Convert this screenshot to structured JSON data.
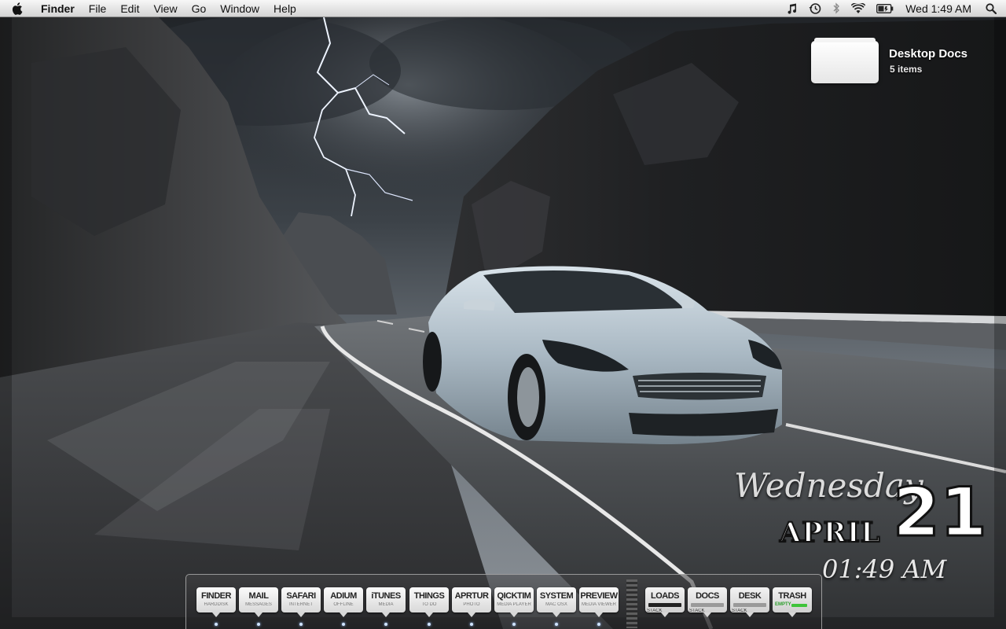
{
  "menubar": {
    "app_name": "Finder",
    "menus": [
      "File",
      "Edit",
      "View",
      "Go",
      "Window",
      "Help"
    ],
    "status_icons": [
      "itunes-note-icon",
      "time-machine-icon",
      "bluetooth-icon",
      "wifi-icon",
      "battery-icon"
    ],
    "clock": "Wed 1:49 AM"
  },
  "desktop": {
    "stack_name": "Desktop Docs",
    "stack_count": "5 items"
  },
  "date_widget": {
    "weekday": "Wednesday",
    "month": "APRIL",
    "day": "21",
    "time": "01:49 AM"
  },
  "dock": {
    "apps": [
      {
        "label": "FINDER",
        "sub": "HARDDISK",
        "running": true
      },
      {
        "label": "MAIL",
        "sub": "MESSAGES",
        "running": true
      },
      {
        "label": "SAFARI",
        "sub": "INTERNET",
        "running": true
      },
      {
        "label": "ADIUM",
        "sub": "OFFLINE",
        "running": true
      },
      {
        "label": "iTUNES",
        "sub": "MEDIA",
        "running": true
      },
      {
        "label": "THINGS",
        "sub": "TO DO",
        "running": true
      },
      {
        "label": "APRTUR",
        "sub": "PHOTO",
        "running": true
      },
      {
        "label": "QICKTIM",
        "sub": "MEDIA PLAYER",
        "running": true
      },
      {
        "label": "SYSTEM",
        "sub": "MAC OSX",
        "running": true
      },
      {
        "label": "PREVIEW",
        "sub": "MEDIA VIEWER",
        "running": true
      }
    ],
    "stacks": [
      {
        "label": "LOADS",
        "sub": "STACK"
      },
      {
        "label": "DOCS",
        "sub": "STACK"
      },
      {
        "label": "DESK",
        "sub": "STACK"
      },
      {
        "label": "TRASH",
        "sub": "EMPTY"
      }
    ]
  }
}
